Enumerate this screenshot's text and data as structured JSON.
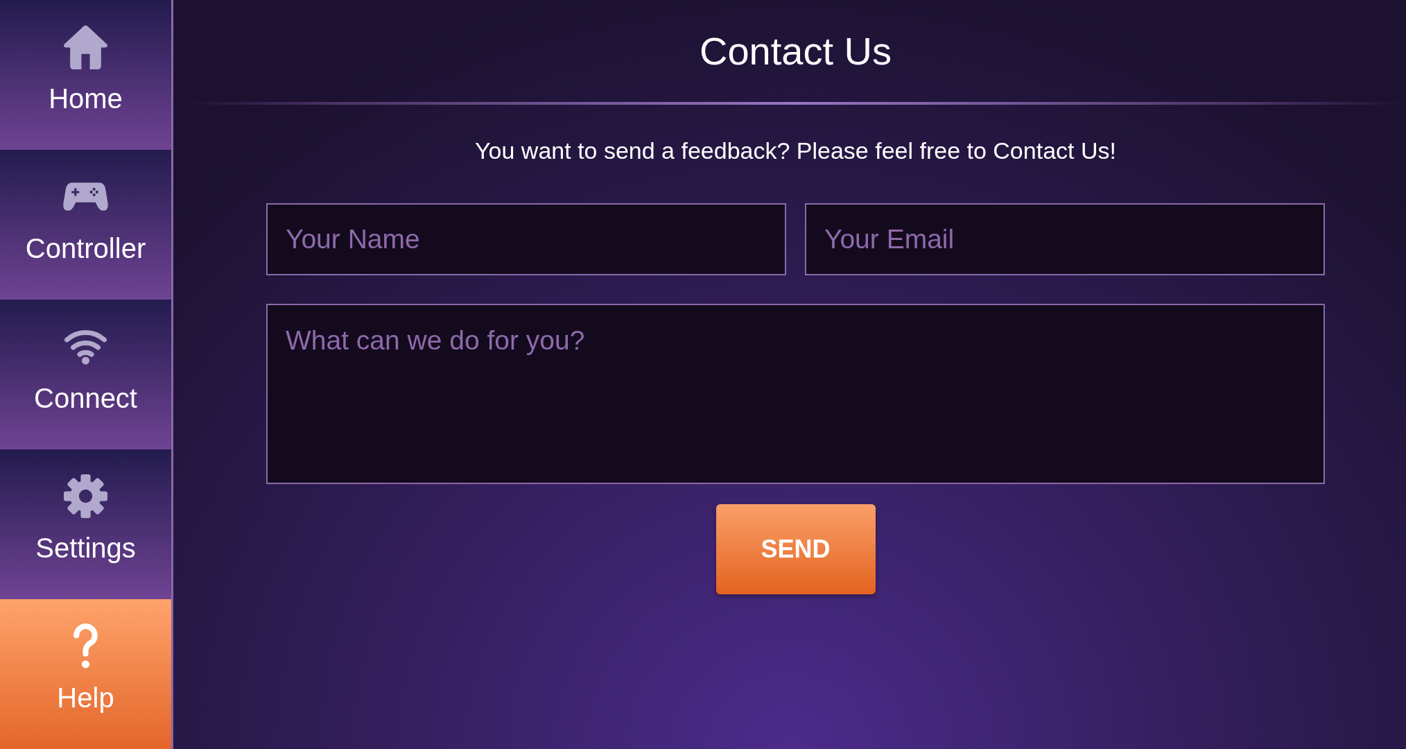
{
  "sidebar": {
    "items": [
      {
        "label": "Home",
        "selected": false
      },
      {
        "label": "Controller",
        "selected": false
      },
      {
        "label": "Connect",
        "selected": false
      },
      {
        "label": "Settings",
        "selected": false
      },
      {
        "label": "Help",
        "selected": true
      }
    ]
  },
  "page": {
    "title": "Contact Us",
    "intro": "You want to send a feedback? Please feel free to Contact Us!"
  },
  "form": {
    "name_field": {
      "placeholder": "Your Name"
    },
    "email_field": {
      "placeholder": "Your Email"
    },
    "message_field": {
      "placeholder": "What can we do for you?"
    },
    "send_button": "SEND"
  }
}
